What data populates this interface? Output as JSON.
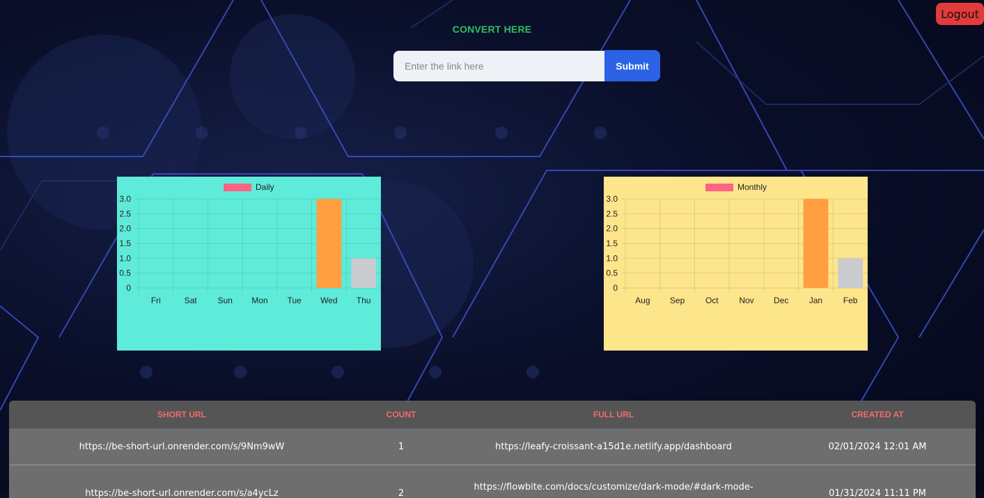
{
  "header": {
    "logout_label": "Logout"
  },
  "converter": {
    "title": "CONVERT HERE",
    "input_placeholder": "Enter the link here",
    "input_value": "",
    "submit_label": "Submit"
  },
  "colors": {
    "daily_bg": "#5EEBD9",
    "monthly_bg": "#FDE58B",
    "legend_swatch": "#FF6384",
    "bar_orange": "#FF9F40",
    "bar_grey": "#C9CBCF",
    "accent_blue": "#2C63E6",
    "logout_red": "#E23B3B",
    "title_green": "#2FBF5F",
    "table_header_text": "#F26B6B"
  },
  "chart_data": [
    {
      "type": "bar",
      "legend": "Daily",
      "categories": [
        "Fri",
        "Sat",
        "Sun",
        "Mon",
        "Tue",
        "Wed",
        "Thu"
      ],
      "values": [
        0,
        0,
        0,
        0,
        0,
        3,
        1
      ],
      "ylim": [
        0,
        3
      ],
      "yticks": [
        "0",
        "0.5",
        "1.0",
        "1.5",
        "2.0",
        "2.5",
        "3.0"
      ],
      "grid": true,
      "legend_position": "top"
    },
    {
      "type": "bar",
      "legend": "Monthly",
      "categories": [
        "Aug",
        "Sep",
        "Oct",
        "Nov",
        "Dec",
        "Jan",
        "Feb"
      ],
      "values": [
        0,
        0,
        0,
        0,
        0,
        3,
        1
      ],
      "ylim": [
        0,
        3
      ],
      "yticks": [
        "0",
        "0.5",
        "1.0",
        "1.5",
        "2.0",
        "2.5",
        "3.0"
      ],
      "grid": true,
      "legend_position": "top"
    }
  ],
  "table": {
    "headers": [
      "SHORT URL",
      "COUNT",
      "FULL URL",
      "CREATED AT"
    ],
    "rows": [
      {
        "short_url": "https://be-short-url.onrender.com/s/9Nm9wW",
        "count": "1",
        "full_url": "https://leafy-croissant-a15d1e.netlify.app/dashboard",
        "created_at": "02/01/2024 12:01 AM"
      },
      {
        "short_url": "https://be-short-url.onrender.com/s/a4ycLz",
        "count": "2",
        "full_url": "https://flowbite.com/docs/customize/dark-mode/#dark-mode-",
        "created_at": "01/31/2024 11:11 PM"
      }
    ]
  }
}
